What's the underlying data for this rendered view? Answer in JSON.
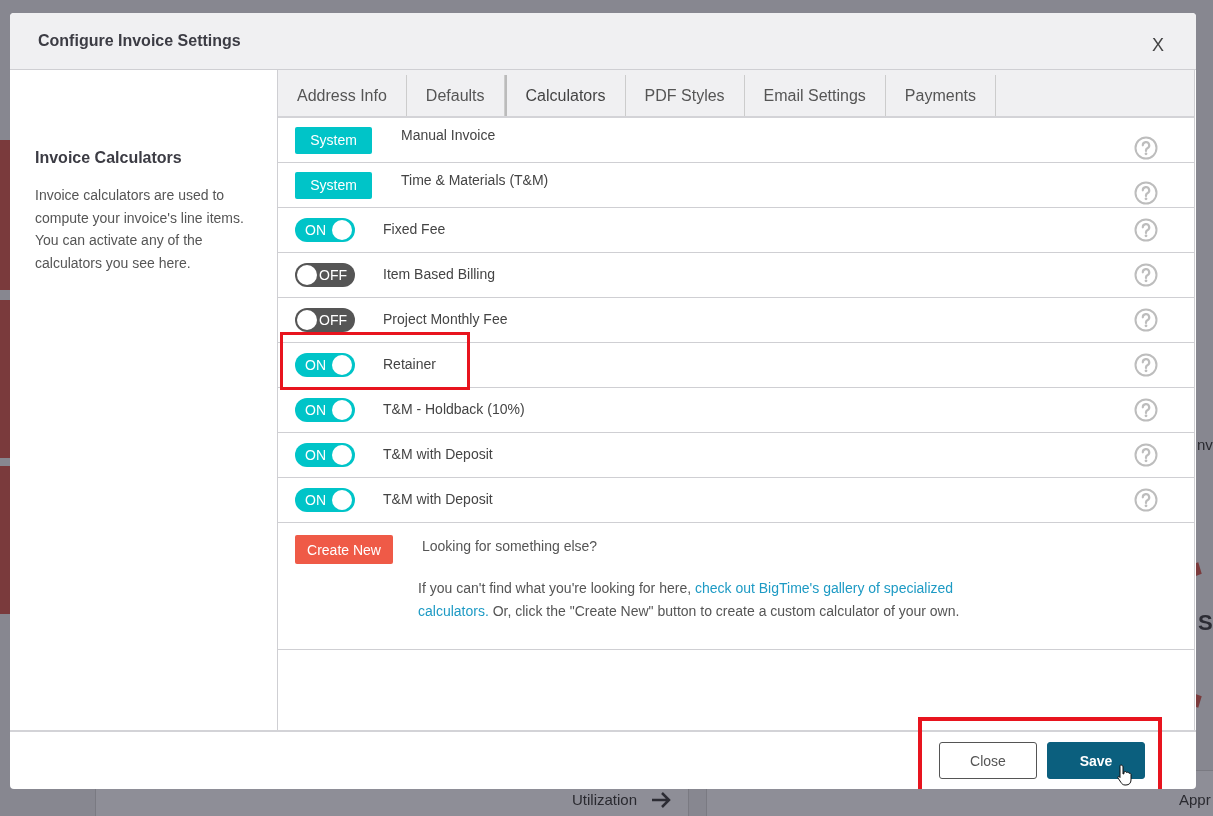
{
  "background": {
    "texts": [
      {
        "text": "Utilization",
        "kind": "link"
      },
      {
        "text": "Appr",
        "kind": "plain"
      },
      {
        "text": "nv",
        "kind": "plain"
      },
      {
        "text": "S",
        "kind": "big"
      }
    ]
  },
  "dialog": {
    "title": "Configure Invoice Settings",
    "close_label": "X",
    "sidebar": {
      "heading": "Invoice Calculators",
      "description": "Invoice calculators are used to compute your invoice's line items. You can activate any of the calculators you see here."
    },
    "tabs": [
      {
        "label": "Address Info",
        "selected": false
      },
      {
        "label": "Defaults",
        "selected": false
      },
      {
        "label": "Calculators",
        "selected": true
      },
      {
        "label": "PDF Styles",
        "selected": false
      },
      {
        "label": "Email Settings",
        "selected": false
      },
      {
        "label": "Payments",
        "selected": false
      }
    ],
    "calculators": [
      {
        "kind": "system",
        "badge": "System",
        "name": "Manual Invoice",
        "highlighted": false
      },
      {
        "kind": "system",
        "badge": "System",
        "name": "Time & Materials (T&M)",
        "highlighted": false
      },
      {
        "kind": "toggle",
        "on": true,
        "toggle_label": "ON",
        "name": "Fixed Fee",
        "highlighted": false
      },
      {
        "kind": "toggle",
        "on": false,
        "toggle_label": "OFF",
        "name": "Item Based Billing",
        "highlighted": false
      },
      {
        "kind": "toggle",
        "on": false,
        "toggle_label": "OFF",
        "name": "Project Monthly Fee",
        "highlighted": false
      },
      {
        "kind": "toggle",
        "on": true,
        "toggle_label": "ON",
        "name": "Retainer",
        "highlighted": true
      },
      {
        "kind": "toggle",
        "on": true,
        "toggle_label": "ON",
        "name": "T&M - Holdback (10%)",
        "highlighted": false
      },
      {
        "kind": "toggle",
        "on": true,
        "toggle_label": "ON",
        "name": "T&M with Deposit",
        "highlighted": false
      },
      {
        "kind": "toggle",
        "on": true,
        "toggle_label": "ON",
        "name": "T&M with Deposit",
        "highlighted": false
      }
    ],
    "create_new": {
      "button": "Create New",
      "heading": "Looking for something else?",
      "text_before": "If you can't find what you're looking for here, ",
      "link_parts": [
        "check out BigTime's gallery of specialized",
        "calculators."
      ],
      "text_after": " Or, click the \"Create New\" button to create a custom calculator of your own."
    },
    "footer": {
      "close": "Close",
      "save": "Save",
      "highlighted": true
    }
  }
}
